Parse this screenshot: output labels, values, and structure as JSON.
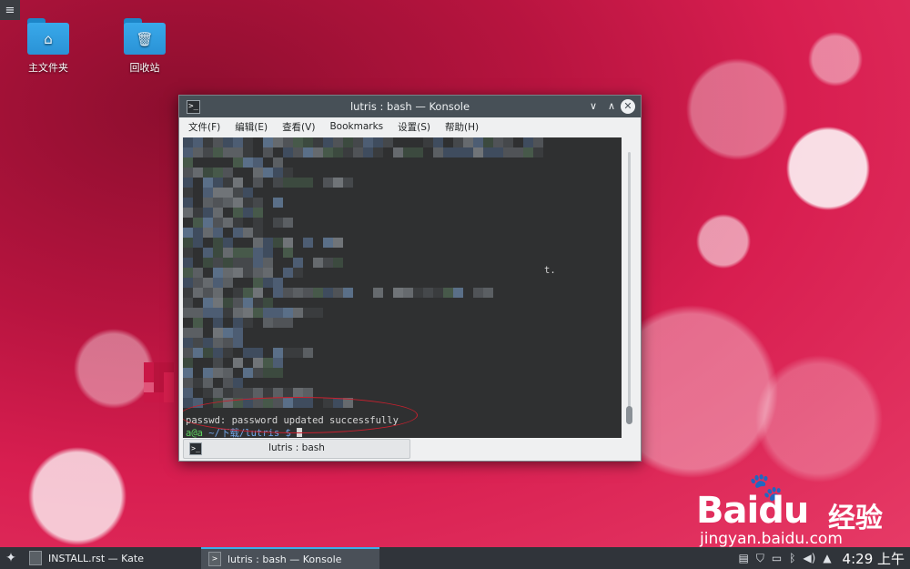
{
  "desktop": {
    "menu_glyph": "≡",
    "icons": [
      {
        "label": "主文件夹",
        "icon": "home-folder-icon",
        "glyph": "⌂"
      },
      {
        "label": "回收站",
        "icon": "trash-folder-icon",
        "glyph": "🗑"
      }
    ]
  },
  "konsole": {
    "title": "lutris : bash — Konsole",
    "app_icon_glyph": ">_",
    "controls": {
      "minimize": "∨",
      "maximize": "∧",
      "close": "✕"
    },
    "menu": [
      "文件(F)",
      "编辑(E)",
      "查看(V)",
      "Bookmarks",
      "设置(S)",
      "帮助(H)"
    ],
    "terminal": {
      "fragment_t": "t.",
      "output_line": "passwd: password updated successfully",
      "prompt_user": "a@a",
      "prompt_path": "~/下载/lutris $"
    },
    "session_tab": "lutris : bash"
  },
  "watermark": {
    "brand": "Bai",
    "brand_suffix": "du",
    "cjk": "经验",
    "url": "jingyan.baidu.com"
  },
  "taskbar": {
    "tasks": [
      {
        "label": "INSTALL.rst  — Kate",
        "active": false
      },
      {
        "label": "lutris : bash — Konsole",
        "active": true
      }
    ],
    "tray_icons": [
      "clipboard-icon",
      "shield-icon",
      "network-icon",
      "bluetooth-icon",
      "volume-icon",
      "expand-tray-icon"
    ],
    "clock": "4:29 上午"
  },
  "colors": {
    "accent": "#3daee9",
    "titlebar": "#475057",
    "terminal_bg": "#2f3031",
    "annotation": "#c8202e"
  }
}
